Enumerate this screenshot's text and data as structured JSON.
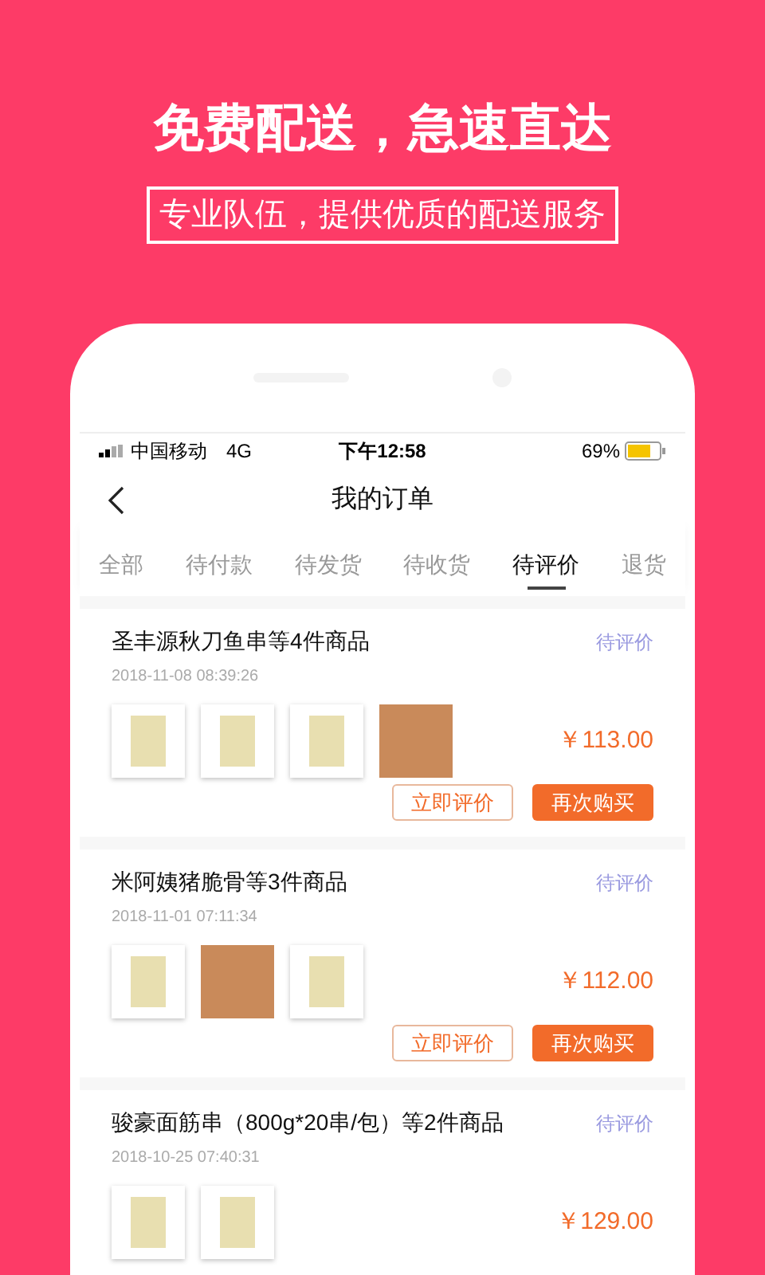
{
  "headline": "免费配送，急速直达",
  "subheadline": "专业队伍，提供优质的配送服务",
  "status_bar": {
    "carrier": "中国移动",
    "network": "4G",
    "time": "下午12:58",
    "battery": "69%"
  },
  "nav": {
    "title": "我的订单"
  },
  "tabs": [
    {
      "label": "全部",
      "selected": false
    },
    {
      "label": "待付款",
      "selected": false
    },
    {
      "label": "待发货",
      "selected": false
    },
    {
      "label": "待收货",
      "selected": false
    },
    {
      "label": "待评价",
      "selected": true
    },
    {
      "label": "退货",
      "selected": false
    }
  ],
  "orders": [
    {
      "title": "圣丰源秋刀鱼串等4件商品",
      "date": "2018-11-08 08:39:26",
      "status": "待评价",
      "price": "￥113.00",
      "photos": [
        {
          "kind": "package"
        },
        {
          "kind": "package"
        },
        {
          "kind": "package"
        },
        {
          "kind": "dish"
        }
      ],
      "actions": [
        {
          "label": "立即评价",
          "kind": "outline"
        },
        {
          "label": "再次购买",
          "kind": "solid"
        }
      ]
    },
    {
      "title": "米阿姨猪脆骨等3件商品",
      "date": "2018-11-01 07:11:34",
      "status": "待评价",
      "price": "￥112.00",
      "photos": [
        {
          "kind": "package"
        },
        {
          "kind": "dish"
        },
        {
          "kind": "package"
        }
      ],
      "actions": [
        {
          "label": "立即评价",
          "kind": "outline"
        },
        {
          "label": "再次购买",
          "kind": "solid"
        }
      ]
    },
    {
      "title": "骏豪面筋串（800g*20串/包）等2件商品",
      "date": "2018-10-25 07:40:31",
      "status": "待评价",
      "price": "￥129.00",
      "photos": [
        {
          "kind": "package"
        },
        {
          "kind": "package"
        }
      ]
    }
  ]
}
